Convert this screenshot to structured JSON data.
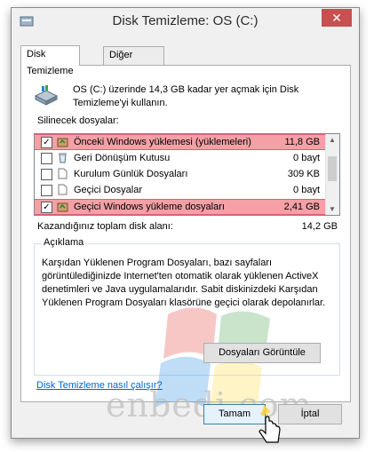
{
  "window": {
    "title": "Disk Temizleme:  OS (C:)",
    "close_label": "✕"
  },
  "tabs": [
    {
      "label": "Disk Temizleme",
      "active": true
    },
    {
      "label": "Diğer Seçenekler",
      "active": false
    }
  ],
  "drive": {
    "description": "OS (C:) üzerinde 14,3 GB kadar yer açmak için Disk Temizleme'yi kullanın."
  },
  "files_label": "Silinecek dosyalar:",
  "files": [
    {
      "name": "Önceki Windows yüklemesi (yüklemeleri)",
      "size": "11,8 GB",
      "checked": true,
      "highlight": true,
      "icon": "recycle-folder-icon"
    },
    {
      "name": "Geri Dönüşüm Kutusu",
      "size": "0 bayt",
      "checked": false,
      "highlight": false,
      "icon": "recycle-bin-icon"
    },
    {
      "name": "Kurulum Günlük Dosyaları",
      "size": "309 KB",
      "checked": false,
      "highlight": false,
      "icon": "document-icon"
    },
    {
      "name": "Geçici Dosyalar",
      "size": "0 bayt",
      "checked": false,
      "highlight": false,
      "icon": "document-icon"
    },
    {
      "name": "Geçici Windows yükleme dosyaları",
      "size": "2,41 GB",
      "checked": true,
      "highlight": true,
      "icon": "recycle-folder-icon"
    }
  ],
  "gain": {
    "label": "Kazandığınız toplam disk alanı:",
    "value": "14,2 GB"
  },
  "description": {
    "title": "Açıklama",
    "text": "Karşıdan Yüklenen Program Dosyaları, bazı sayfaları görüntülediğinizde Internet'ten otomatik olarak yüklenen ActiveX denetimleri ve Java uygulamalarıdır. Sabit diskinizdeki Karşıdan Yüklenen Program Dosyaları klasörüne geçici olarak depolanırlar."
  },
  "buttons": {
    "view_files": "Dosyaları Görüntüle",
    "ok": "Tamam",
    "cancel": "İptal"
  },
  "help_link": "Disk Temizleme nasıl çalışır?",
  "watermark": "enbedi.com"
}
